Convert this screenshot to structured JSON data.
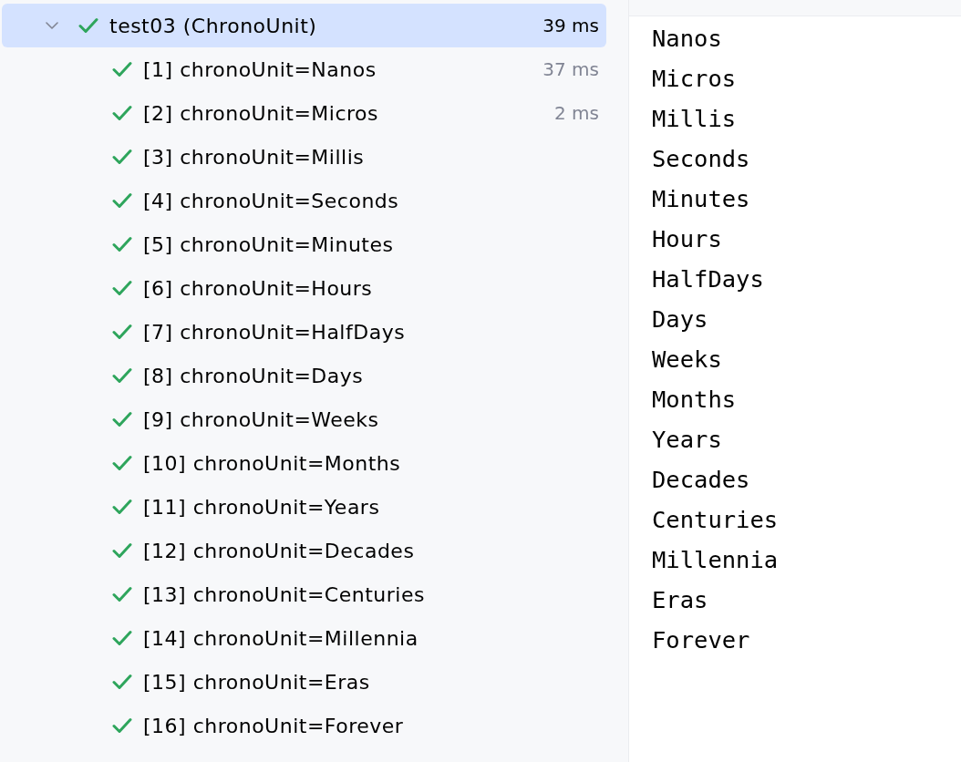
{
  "tree": {
    "root": {
      "label": "test03 (ChronoUnit)",
      "passed": true,
      "expanded": true,
      "selected": true,
      "duration": "39 ms",
      "children": [
        {
          "label": "[1] chronoUnit=Nanos",
          "passed": true,
          "selected": false,
          "duration": "37 ms"
        },
        {
          "label": "[2] chronoUnit=Micros",
          "passed": true,
          "selected": false,
          "duration": "2 ms"
        },
        {
          "label": "[3] chronoUnit=Millis",
          "passed": true,
          "selected": false
        },
        {
          "label": "[4] chronoUnit=Seconds",
          "passed": true,
          "selected": false
        },
        {
          "label": "[5] chronoUnit=Minutes",
          "passed": true,
          "selected": false
        },
        {
          "label": "[6] chronoUnit=Hours",
          "passed": true,
          "selected": false
        },
        {
          "label": "[7] chronoUnit=HalfDays",
          "passed": true,
          "selected": false
        },
        {
          "label": "[8] chronoUnit=Days",
          "passed": true,
          "selected": false
        },
        {
          "label": "[9] chronoUnit=Weeks",
          "passed": true,
          "selected": false
        },
        {
          "label": "[10] chronoUnit=Months",
          "passed": true,
          "selected": false
        },
        {
          "label": "[11] chronoUnit=Years",
          "passed": true,
          "selected": false
        },
        {
          "label": "[12] chronoUnit=Decades",
          "passed": true,
          "selected": false
        },
        {
          "label": "[13] chronoUnit=Centuries",
          "passed": true,
          "selected": false
        },
        {
          "label": "[14] chronoUnit=Millennia",
          "passed": true,
          "selected": false
        },
        {
          "label": "[15] chronoUnit=Eras",
          "passed": true,
          "selected": false
        },
        {
          "label": "[16] chronoUnit=Forever",
          "passed": true,
          "selected": false
        }
      ]
    }
  },
  "console": {
    "lines": [
      "Nanos",
      "Micros",
      "Millis",
      "Seconds",
      "Minutes",
      "Hours",
      "HalfDays",
      "Days",
      "Weeks",
      "Months",
      "Years",
      "Decades",
      "Centuries",
      "Millennia",
      "Eras",
      "Forever"
    ]
  }
}
